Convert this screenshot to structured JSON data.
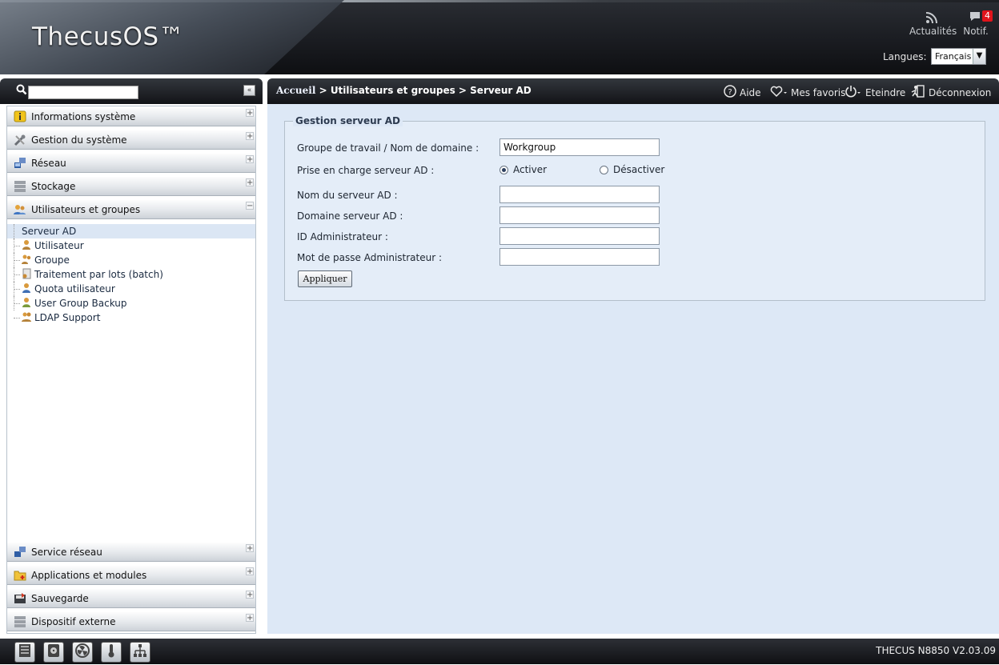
{
  "header": {
    "logo": "ThecusOS™",
    "news_label": "Actualités",
    "notif_label": "Notif.",
    "notif_count": "4",
    "lang_label": "Langues:",
    "lang_value": "Français"
  },
  "sidebar": {
    "search_placeholder": "",
    "collapse_label": "«",
    "sections_top": [
      {
        "label": "Informations système",
        "icon": "info-icon"
      },
      {
        "label": "Gestion du système",
        "icon": "tools-icon"
      },
      {
        "label": "Réseau",
        "icon": "network-icon"
      },
      {
        "label": "Stockage",
        "icon": "storage-icon"
      },
      {
        "label": "Utilisateurs et groupes",
        "icon": "users-icon"
      }
    ],
    "tree": [
      {
        "label": "Serveur AD"
      },
      {
        "label": "Utilisateur"
      },
      {
        "label": "Groupe"
      },
      {
        "label": "Traitement par lots (batch)"
      },
      {
        "label": "Quota utilisateur"
      },
      {
        "label": "User Group Backup"
      },
      {
        "label": "LDAP Support"
      }
    ],
    "sections_bottom": [
      {
        "label": "Service réseau",
        "icon": "service-icon"
      },
      {
        "label": "Applications et modules",
        "icon": "apps-icon"
      },
      {
        "label": "Sauvegarde",
        "icon": "backup-icon"
      },
      {
        "label": "Dispositif externe",
        "icon": "external-device-icon"
      }
    ]
  },
  "topbar": {
    "home": "Accueil",
    "path": " > Utilisateurs et groupes > Serveur AD",
    "help": "Aide",
    "favorites": "Mes favoris",
    "shutdown": "Eteindre",
    "logout": "Déconnexion"
  },
  "form": {
    "legend": "Gestion serveur AD",
    "workgroup_label": "Groupe de travail / Nom de domaine :",
    "workgroup_value": "Workgroup",
    "ad_support_label": "Prise en charge serveur AD :",
    "enable_label": "Activer",
    "disable_label": "Désactiver",
    "server_name_label": "Nom du serveur AD :",
    "server_name_value": "",
    "domain_label": "Domaine serveur AD :",
    "domain_value": "",
    "admin_id_label": "ID Administrateur :",
    "admin_id_value": "",
    "admin_pwd_label": "Mot de passe Administrateur :",
    "admin_pwd_value": "",
    "apply_label": "Appliquer"
  },
  "footer": {
    "version": "THECUS N8850 V2.03.09"
  },
  "colors": {
    "content_bg": "#dde8f6",
    "header_dark": "#1a1c21",
    "badge": "#e0141b"
  }
}
